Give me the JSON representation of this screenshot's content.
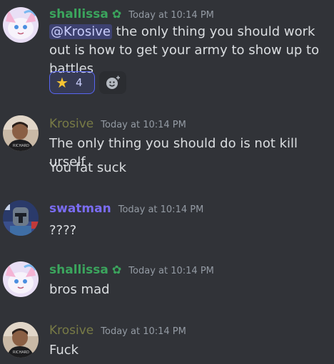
{
  "messages": [
    {
      "username": "shallissa",
      "badge_icon": "flower-badge-icon",
      "badge_glyph": "✿",
      "timestamp": "Today at 10:14 PM",
      "mention": "@Krosive",
      "text_rest": " the only thing you should work out is how to get your army to show up to battles",
      "reactions": [
        {
          "emoji": "★",
          "emoji_name": "star-icon",
          "count": "4"
        }
      ],
      "add_reaction_icon": "add-reaction-icon"
    },
    {
      "username": "Krosive",
      "timestamp": "Today at 10:14 PM",
      "lines": [
        "The only thing you should do is not kill urself",
        "You fat suck"
      ]
    },
    {
      "username": "swatman",
      "timestamp": "Today at 10:14 PM",
      "text": "????"
    },
    {
      "username": "shallissa",
      "badge_glyph": "✿",
      "timestamp": "Today at 10:14 PM",
      "text": "bros mad"
    },
    {
      "username": "Krosive",
      "timestamp": "Today at 10:14 PM",
      "text": "Fuck"
    }
  ],
  "colors": {
    "background": "#313338",
    "shallissa_name": "#3ba55d",
    "krosive_name": "#787b46",
    "swatman_name": "#7a6cf2",
    "timestamp": "#949ba4",
    "mention_bg": "#5865f2"
  }
}
